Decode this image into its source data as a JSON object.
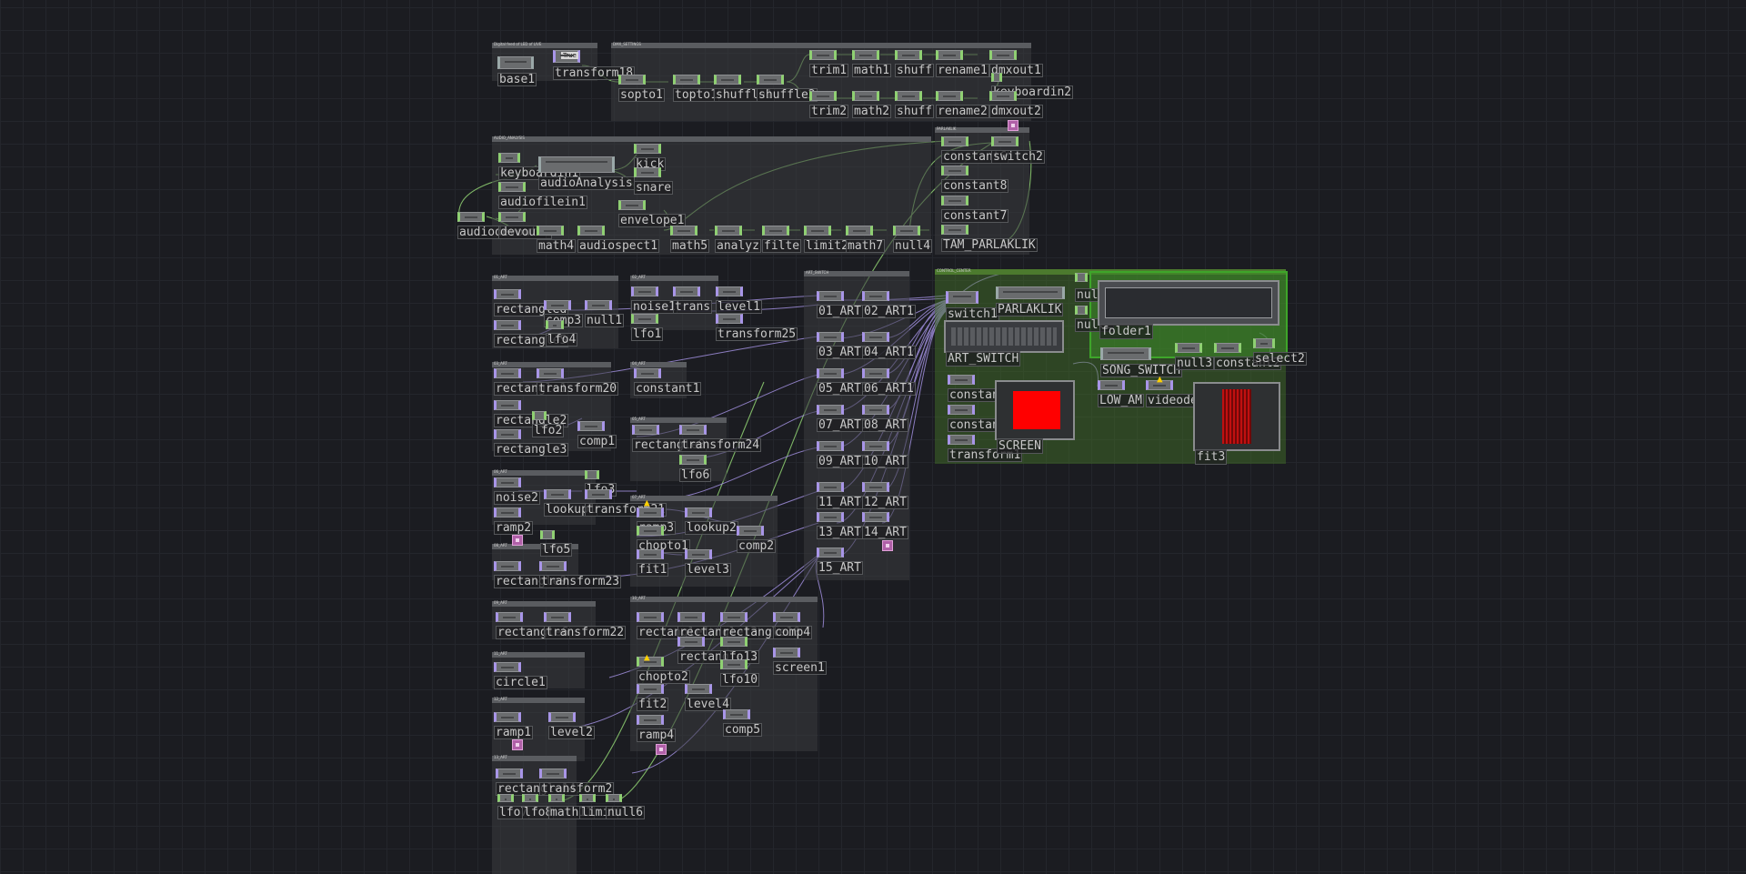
{
  "network": {
    "colors": {
      "background": "#1b1c21",
      "chop_wire": "#8fd072",
      "top_wire": "#a895e8",
      "annotation": "#3a3c40",
      "control_center": "#3ea52a"
    },
    "annotations": [
      "Digital feed of LED of LIVE",
      "DMX_SETTINGS",
      "AUDIO_ANALYSIS",
      "PARLAKLIK",
      "01_ART",
      "02_ART",
      "ART_SWITCH",
      "CONTROL_CENTER",
      "03_ART",
      "04_ART",
      "05_ART",
      "06_ART",
      "07_ART",
      "08_ART",
      "09_ART",
      "10_ART",
      "11_ART",
      "12_ART",
      "13_ART",
      "14_ART"
    ],
    "operators": {
      "base1": "base1",
      "transform18": "transform18",
      "button_value": "True",
      "sopto1": "sopto1",
      "topto1": "topto1",
      "shuffle1": "shuffle1",
      "shuffle2": "shuffle2",
      "trim1": "trim1",
      "math1": "math1",
      "shuff1": "shuff",
      "rename1": "rename1",
      "dmxout1": "dmxout1",
      "keyboardin2": "keyboardin2",
      "trim2": "trim2",
      "math2": "math2",
      "shuff2": "shuff",
      "rename2": "rename2",
      "dmxout2": "dmxout2",
      "keyboardin1": "keyboardin1",
      "audioAnalysis": "audioAnalysis",
      "kick": "kick",
      "snare": "snare",
      "audiofilein1": "audiofilein1",
      "envelope1": "envelope1",
      "audiodevout1": "audiodevout1",
      "audiodevout2": "devout2",
      "math4": "math4",
      "audiospect1": "audiospect1",
      "math5": "math5",
      "analyze": "analyz",
      "filter": "filte",
      "limit2": "limit2",
      "math7": "math7",
      "null4": "null4",
      "constant6": "constant6",
      "switch2": "switch2",
      "constant8": "constant8",
      "constant7": "constant7",
      "TAM_PARLAKLIK": "TAM_PARLAKLIK",
      "rectangle_a": "rectangled",
      "comp3": "comp3",
      "null1": "null1",
      "rectangle5": "rectangle5",
      "lfo4": "lfo4",
      "noise1": "noise1",
      "transform_a": "trans",
      "level1": "level1",
      "lfo1": "lfo1",
      "transform25": "transform25",
      "art01": "01_ART",
      "art02": "02_ART1",
      "art03": "03_ART1",
      "art04": "04_ART1",
      "art05": "05_ART1",
      "art06": "06_ART1",
      "art07": "07_ART1",
      "art08": "08_ART",
      "art09": "09_ART1",
      "art10": "10_ART",
      "art11": "11_ART",
      "art12": "12_ART",
      "art13": "13_ART",
      "art14": "14_ART",
      "art15": "15_ART",
      "rectangle1": "rectangle1",
      "transform20": "transform20",
      "rectangle2": "rectangle2",
      "lfo2": "lfo2",
      "rectangle3": "rectangle3",
      "comp1": "comp1",
      "constant1": "constant1",
      "rectangle_b": "rectangle8",
      "transform24": "transform24",
      "lfo6": "lfo6",
      "noise2": "noise2",
      "lfo3": "lfo3",
      "lookup1": "lookup1",
      "transform21": "transform21",
      "ramp2": "ramp2",
      "ramp3": "ramp3",
      "lookup2": "lookup2",
      "chopto1": "chopto1",
      "comp2": "comp2",
      "lfo5": "lfo5",
      "rectangle_c": "rectangle9",
      "transform23": "transform23",
      "fit1": "fit1",
      "level3": "level3",
      "rectangle_d": "rectangle6",
      "transform22": "transform22",
      "rectangle_e": "rectangle1",
      "rectangle_f": "rectangle13",
      "rectangle_g": "rectangle10",
      "comp4": "comp4",
      "rectangle12": "rectangle12",
      "lfo13": "lfo13",
      "chopto2": "chopto2",
      "lfo10": "lfo10",
      "screen1": "screen1",
      "circle1": "circle1",
      "fit2": "fit2",
      "level4": "level4",
      "ramp1": "ramp1",
      "level2": "level2",
      "ramp4": "ramp4",
      "comp5": "comp5",
      "rectangle14": "rectangle14",
      "transform2": "transform2",
      "lfo7": "lfo7",
      "lfo8": "lfo8",
      "math11": "math11",
      "limit": "limit",
      "null6": "null6",
      "switch1": "switch1",
      "PARLAKLIK": "PARLAKLIK",
      "ART_SWITCH": "ART_SWITCH",
      "null5": "null5",
      "null2": "null2",
      "folder1": "folder1",
      "SONG_SWITCH": "SONG_SWITCH",
      "null3": "null3",
      "constant2": "constant2",
      "select2": "select2",
      "constant4": "constant4",
      "constant5": "constant5",
      "transform1": "transform1",
      "SCREEN": "SCREEN",
      "LOW_AM": "LOW_AM",
      "videodevin1": "videodevin1",
      "fit3": "fit3"
    }
  }
}
